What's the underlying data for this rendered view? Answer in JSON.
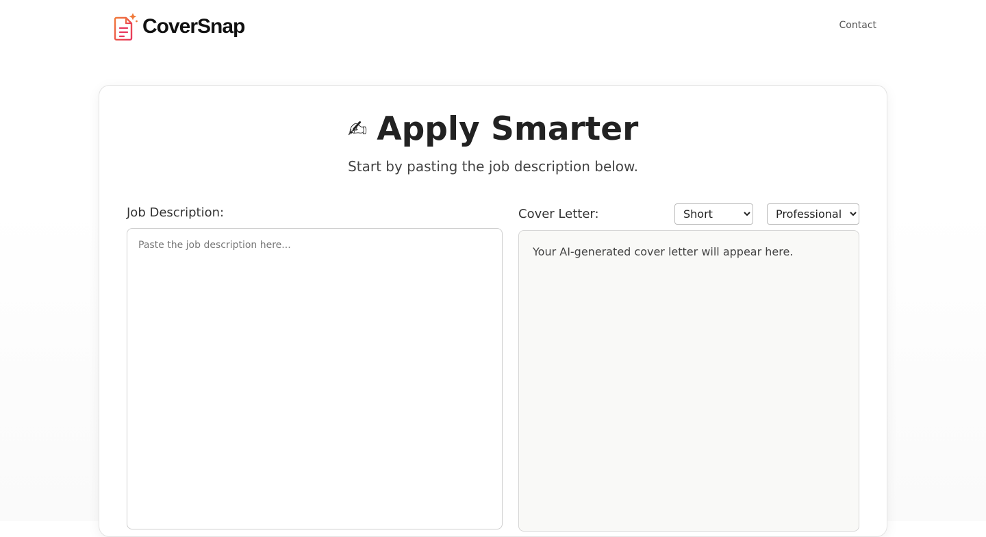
{
  "brand": {
    "name": "CoverSnap",
    "primary_color": "#e8365d",
    "accent_color": "#f07a3a"
  },
  "nav": {
    "contact_label": "Contact"
  },
  "hero": {
    "icon": "writing-hand-icon",
    "emoji": "✍",
    "title": "Apply Smarter",
    "subtitle": "Start by pasting the job description below."
  },
  "job": {
    "label": "Job Description:",
    "placeholder": "Paste the job description here...",
    "value": ""
  },
  "cover": {
    "label": "Cover Letter:",
    "length_options": [
      "Short"
    ],
    "length_selected": "Short",
    "tone_options": [
      "Professional"
    ],
    "tone_selected": "Professional",
    "placeholder": "Your AI-generated cover letter will appear here."
  }
}
